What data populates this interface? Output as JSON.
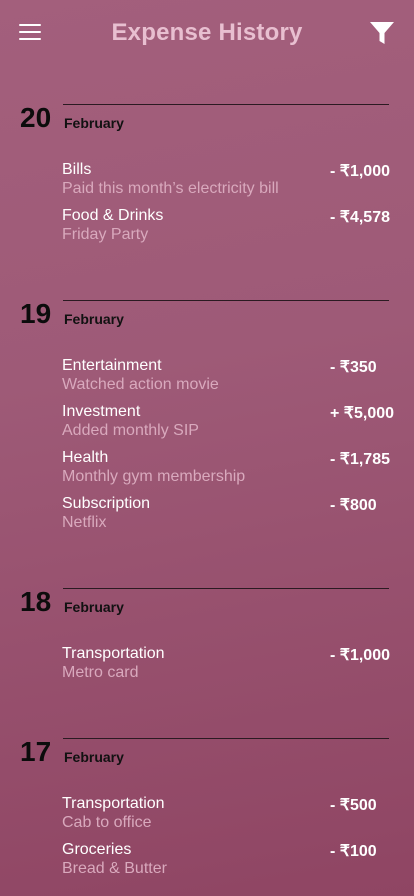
{
  "header": {
    "title": "Expense History",
    "menu_icon": "hamburger-menu-icon",
    "filter_icon": "filter-funnel-icon"
  },
  "groups": [
    {
      "day": "20",
      "month": "February",
      "transactions": [
        {
          "category": "Bills",
          "note": "Paid this month’s electricity bill",
          "amount": "- ₹1,000"
        },
        {
          "category": "Food & Drinks",
          "note": "Friday Party",
          "amount": "- ₹4,578"
        }
      ]
    },
    {
      "day": "19",
      "month": "February",
      "transactions": [
        {
          "category": "Entertainment",
          "note": "Watched action movie",
          "amount": "- ₹350"
        },
        {
          "category": "Investment",
          "note": "Added monthly SIP",
          "amount": "+ ₹5,000"
        },
        {
          "category": "Health",
          "note": "Monthly gym membership",
          "amount": "- ₹1,785"
        },
        {
          "category": "Subscription",
          "note": "Netflix",
          "amount": "- ₹800"
        }
      ]
    },
    {
      "day": "18",
      "month": "February",
      "transactions": [
        {
          "category": "Transportation",
          "note": "Metro card",
          "amount": "- ₹1,000"
        }
      ]
    },
    {
      "day": "17",
      "month": "February",
      "transactions": [
        {
          "category": "Transportation",
          "note": "Cab to office",
          "amount": "- ₹500"
        },
        {
          "category": "Groceries",
          "note": "Bread & Butter",
          "amount": "- ₹100"
        }
      ]
    }
  ]
}
